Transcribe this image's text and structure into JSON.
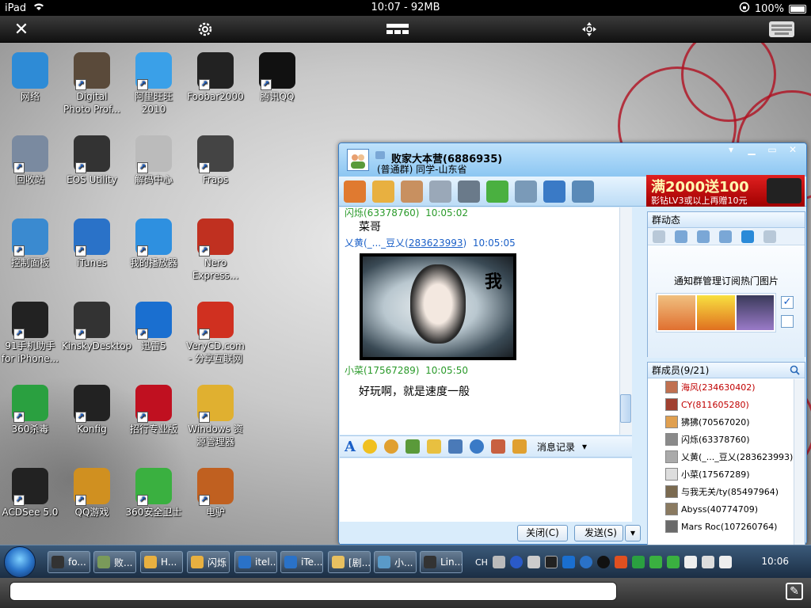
{
  "ios_status": {
    "device": "iPad",
    "time_memory": "10:07 - 92MB",
    "battery": "100%"
  },
  "desktop_icons": [
    {
      "label": "网络",
      "color": "#2e8bd6"
    },
    {
      "label": "Digital Photo Prof...",
      "color": "#5a4a3a"
    },
    {
      "label": "阿里旺旺 2010",
      "color": "#3aa0e8"
    },
    {
      "label": "Foobar2000",
      "color": "#222"
    },
    {
      "label": "腾讯QQ",
      "color": "#111"
    },
    {
      "label": "回收站",
      "color": "#7a8aa0"
    },
    {
      "label": "EOS Utility",
      "color": "#333"
    },
    {
      "label": "解码中心",
      "color": "#bbb"
    },
    {
      "label": "Fraps",
      "color": "#444"
    },
    {
      "label": "控制面板",
      "color": "#3a8ad0"
    },
    {
      "label": "iTunes",
      "color": "#2a72c8"
    },
    {
      "label": "我的播放器",
      "color": "#2e90e0"
    },
    {
      "label": "Nero Express...",
      "color": "#c03020"
    },
    {
      "label": "91手机助手 for iPhone...",
      "color": "#222"
    },
    {
      "label": "KinskyDesktop",
      "color": "#333"
    },
    {
      "label": "迅雷5",
      "color": "#1a6fd0"
    },
    {
      "label": "VeryCD.com - 分享互联网",
      "color": "#d03020"
    },
    {
      "label": "360杀毒",
      "color": "#2aa040"
    },
    {
      "label": "Konfig",
      "color": "#222"
    },
    {
      "label": "招行专业版",
      "color": "#c01020"
    },
    {
      "label": "Windows 资源管理器",
      "color": "#e0b030"
    },
    {
      "label": "ACDSee 5.0",
      "color": "#222"
    },
    {
      "label": "QQ游戏",
      "color": "#d09020"
    },
    {
      "label": "360安全卫士",
      "color": "#3ab040"
    },
    {
      "label": "电驴",
      "color": "#c06020"
    }
  ],
  "qq": {
    "group_name": "败家大本营(6886935)",
    "group_sub": "(普通群) 同学-山东省",
    "ad_line1": "满2000送100",
    "ad_line2": "影钻LV3或以上再赠10元",
    "messages": [
      {
        "sender": "闪烁(63378760)",
        "time": "10:05:02",
        "text": "菜哥"
      },
      {
        "sender": "乂黄(_..._豆乂(",
        "sender_id": "283623993",
        "sender_close": ")",
        "time": "10:05:05",
        "text": ""
      },
      {
        "sender": "小菜(17567289)",
        "time": "10:05:50",
        "text": "好玩啊，就是速度一般"
      }
    ],
    "photo_text": "我",
    "history_label": "消息记录",
    "close_button": "关闭(C)",
    "send_button": "发送(S)",
    "group_feed_title": "群动态",
    "feed_caption": "通知群管理订阅热门图片",
    "members_title": "群成员(9/21)",
    "members": [
      {
        "name": "海风(234630402)",
        "color": "#c00000"
      },
      {
        "name": "CY(811605280)",
        "color": "#c00000"
      },
      {
        "name": "狒狒(70567020)",
        "color": "#000"
      },
      {
        "name": "闪烁(63378760)",
        "color": "#000"
      },
      {
        "name": "乂黄(_..._豆乂(283623993)",
        "color": "#000"
      },
      {
        "name": "小菜(17567289)",
        "color": "#000"
      },
      {
        "name": "与我无关/ty(85497964)",
        "color": "#000"
      },
      {
        "name": "Abyss(40774709)",
        "color": "#000"
      },
      {
        "name": "Mars Roc(107260764)",
        "color": "#000"
      }
    ]
  },
  "taskbar": {
    "tasks": [
      "fo...",
      "败...",
      "H...",
      "闪烁",
      "itel...",
      "iTe...",
      "[剧...",
      "小...",
      "Lin..."
    ],
    "ime": "CH",
    "clock": "10:06"
  }
}
